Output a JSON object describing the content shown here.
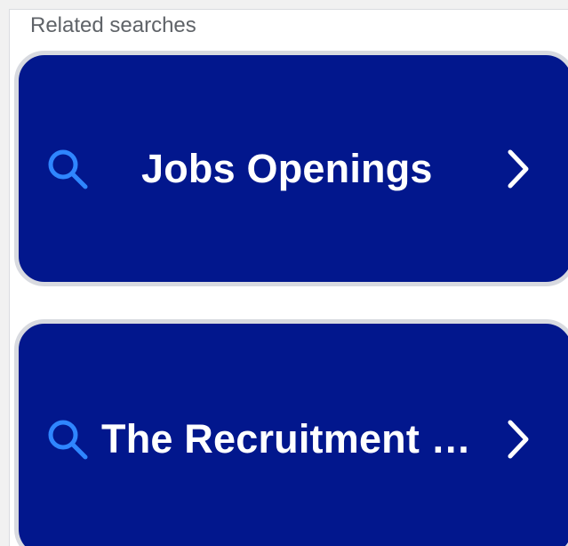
{
  "related_searches": {
    "title": "Related searches",
    "items": [
      {
        "label": "Jobs Openings",
        "leading_icon": "search-icon",
        "trailing_icon": "chevron-right-icon"
      },
      {
        "label": "The Recruitment …",
        "leading_icon": "search-icon",
        "trailing_icon": "chevron-right-icon"
      }
    ]
  },
  "colors": {
    "card_background": "#02178d",
    "card_border": "#d8dae0",
    "search_icon": "#2f86ff",
    "text": "#ffffff",
    "section_title": "#5f6368"
  }
}
